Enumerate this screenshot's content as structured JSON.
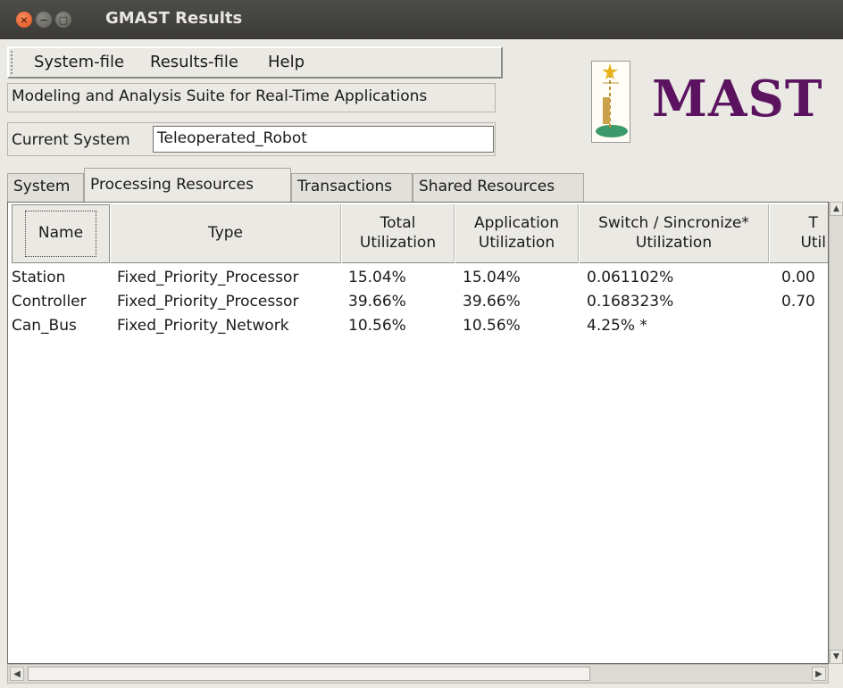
{
  "window": {
    "title": "GMAST Results",
    "close_glyph": "×",
    "min_glyph": "−",
    "max_glyph": "□"
  },
  "menu": {
    "items": [
      "System-file",
      "Results-file",
      "Help"
    ]
  },
  "suite_title": "Modeling and Analysis Suite for Real-Time Applications",
  "current_system": {
    "label": "Current System",
    "value": "Teleoperated_Robot"
  },
  "logo": {
    "text": "MAST",
    "color": "#5b1360"
  },
  "tabs": [
    "System",
    "Processing Resources",
    "Transactions",
    "Shared Resources"
  ],
  "active_tab": "Processing Resources",
  "table": {
    "headers": [
      "Name",
      "Type",
      "Total\nUtilization",
      "Application\nUtilization",
      "Switch / Sincronize*\nUtilization",
      "T\nUtil"
    ],
    "rows": [
      [
        "Station",
        "Fixed_Priority_Processor",
        "15.04%",
        "15.04%",
        "0.061102%",
        "0.00"
      ],
      [
        "Controller",
        "Fixed_Priority_Processor",
        "39.66%",
        "39.66%",
        "0.168323%",
        "0.70"
      ],
      [
        "Can_Bus",
        "Fixed_Priority_Network",
        "10.56%",
        "10.56%",
        "4.25% *",
        ""
      ]
    ]
  },
  "scroll": {
    "up": "▲",
    "down": "▼",
    "left": "◀",
    "right": "▶"
  }
}
